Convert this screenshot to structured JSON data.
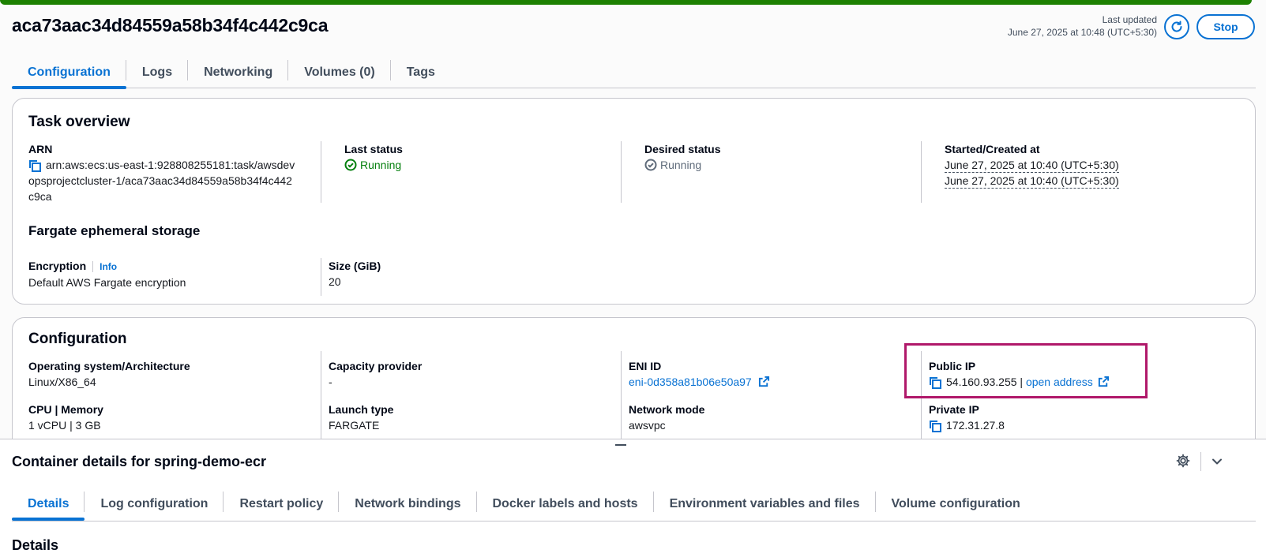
{
  "header": {
    "title": "aca73aac34d84559a58b34f4c442c9ca",
    "last_updated_label": "Last updated",
    "last_updated_value": "June 27, 2025 at 10:48 (UTC+5:30)",
    "stop_label": "Stop"
  },
  "tabs": [
    {
      "label": "Configuration"
    },
    {
      "label": "Logs"
    },
    {
      "label": "Networking"
    },
    {
      "label": "Volumes (0)"
    },
    {
      "label": "Tags"
    }
  ],
  "task_overview": {
    "title": "Task overview",
    "arn_label": "ARN",
    "arn_line1": "arn:aws:ecs:us-east-1:928808255181:task/awsdev",
    "arn_line2": "opsprojectcluster-1/aca73aac34d84559a58b34f4c442",
    "arn_line3": "c9ca",
    "last_status_label": "Last status",
    "last_status_value": "Running",
    "desired_status_label": "Desired status",
    "desired_status_value": "Running",
    "started_label": "Started/Created at",
    "started_value": "June 27, 2025 at 10:40 (UTC+5:30)",
    "created_value": "June 27, 2025 at 10:40 (UTC+5:30)",
    "fargate_title": "Fargate ephemeral storage",
    "encryption_label": "Encryption",
    "info_label": "Info",
    "encryption_value": "Default AWS Fargate encryption",
    "size_label": "Size (GiB)",
    "size_value": "20"
  },
  "configuration": {
    "title": "Configuration",
    "os_label": "Operating system/Architecture",
    "os_value": "Linux/X86_64",
    "capacity_label": "Capacity provider",
    "capacity_value": "-",
    "eni_label": "ENI ID",
    "eni_value": "eni-0d358a81b06e50a97",
    "public_ip_label": "Public IP",
    "public_ip_value": "54.160.93.255",
    "public_ip_sep": "|",
    "open_address_label": "open address",
    "cpu_label": "CPU | Memory",
    "cpu_value": "1 vCPU | 3 GB",
    "launch_label": "Launch type",
    "launch_value": "FARGATE",
    "network_mode_label": "Network mode",
    "network_mode_value": "awsvpc",
    "private_ip_label": "Private IP",
    "private_ip_value": "172.31.27.8"
  },
  "container_panel": {
    "title": "Container details for spring-demo-ecr",
    "tabs": [
      {
        "label": "Details"
      },
      {
        "label": "Log configuration"
      },
      {
        "label": "Restart policy"
      },
      {
        "label": "Network bindings"
      },
      {
        "label": "Docker labels and hosts"
      },
      {
        "label": "Environment variables and files"
      },
      {
        "label": "Volume configuration"
      }
    ],
    "details_heading": "Details"
  },
  "colors": {
    "accent": "#0972d3",
    "success": "#037f0c",
    "highlight": "#b0186a",
    "topbar": "#1d8102"
  }
}
